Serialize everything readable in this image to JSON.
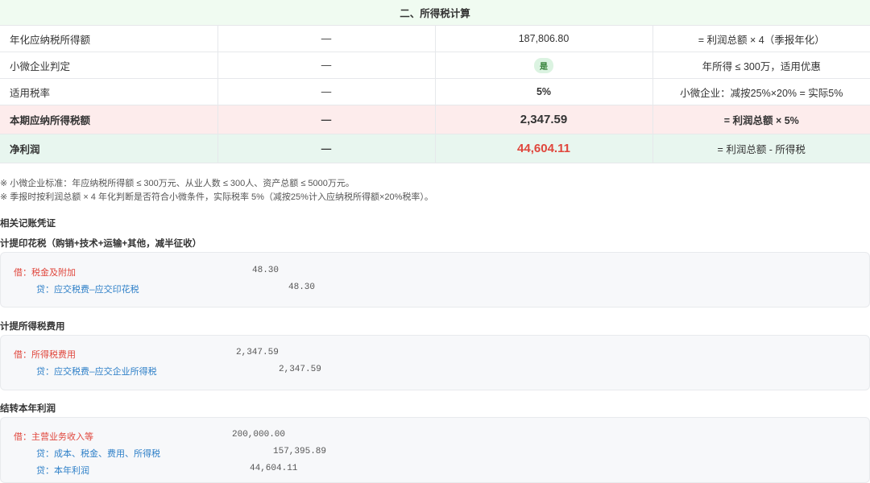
{
  "section_title": "二、所得税计算",
  "rows": [
    {
      "label": "年化应纳税所得额",
      "dash": "—",
      "value": "187,806.80",
      "note": "= 利润总额 × 4（季报年化）"
    },
    {
      "label": "小微企业判定",
      "dash": "—",
      "badge": "是",
      "note": "年所得 ≤ 300万，适用优惠"
    },
    {
      "label": "适用税率",
      "dash": "—",
      "value": "5%",
      "note": "小微企业：减按25%×20% = 实际5%"
    }
  ],
  "tax_row": {
    "label": "本期应纳所得税额",
    "dash": "—",
    "value": "2,347.59",
    "note": "= 利润总额 × 5%"
  },
  "net_row": {
    "label": "净利润",
    "dash": "—",
    "value": "44,604.11",
    "note": "= 利润总额 - 所得税"
  },
  "notes": [
    "※ 小微企业标准：年应纳税所得额 ≤ 300万元、从业人数 ≤ 300人、资产总额 ≤ 5000万元。",
    "※ 季报时按利润总额 × 4 年化判断是否符合小微条件，实际税率 5%（减按25%计入应纳税所得额×20%税率）。"
  ],
  "vouchers_title": "相关记账凭证",
  "vouchers": [
    {
      "title": "计提印花税（购销+技术+运输+其他，减半征收）",
      "lines": [
        {
          "side": "dr",
          "account": "借：税金及附加",
          "amount": "48.30"
        },
        {
          "side": "cr",
          "account": "贷：应交税费—应交印花税",
          "amount": "48.30"
        }
      ]
    },
    {
      "title": "计提所得税费用",
      "lines": [
        {
          "side": "dr",
          "account": "借：所得税费用",
          "amount": "2,347.59"
        },
        {
          "side": "cr",
          "account": "贷：应交税费—应交企业所得税",
          "amount": "2,347.59"
        }
      ]
    },
    {
      "title": "结转本年利润",
      "lines": [
        {
          "side": "dr",
          "account": "借：主营业务收入等",
          "amount": "200,000.00"
        },
        {
          "side": "cr",
          "account": "贷：成本、税金、费用、所得税",
          "amount": "157,395.89"
        },
        {
          "side": "cr",
          "account": "贷：本年利润",
          "amount": "44,604.11"
        }
      ]
    }
  ]
}
